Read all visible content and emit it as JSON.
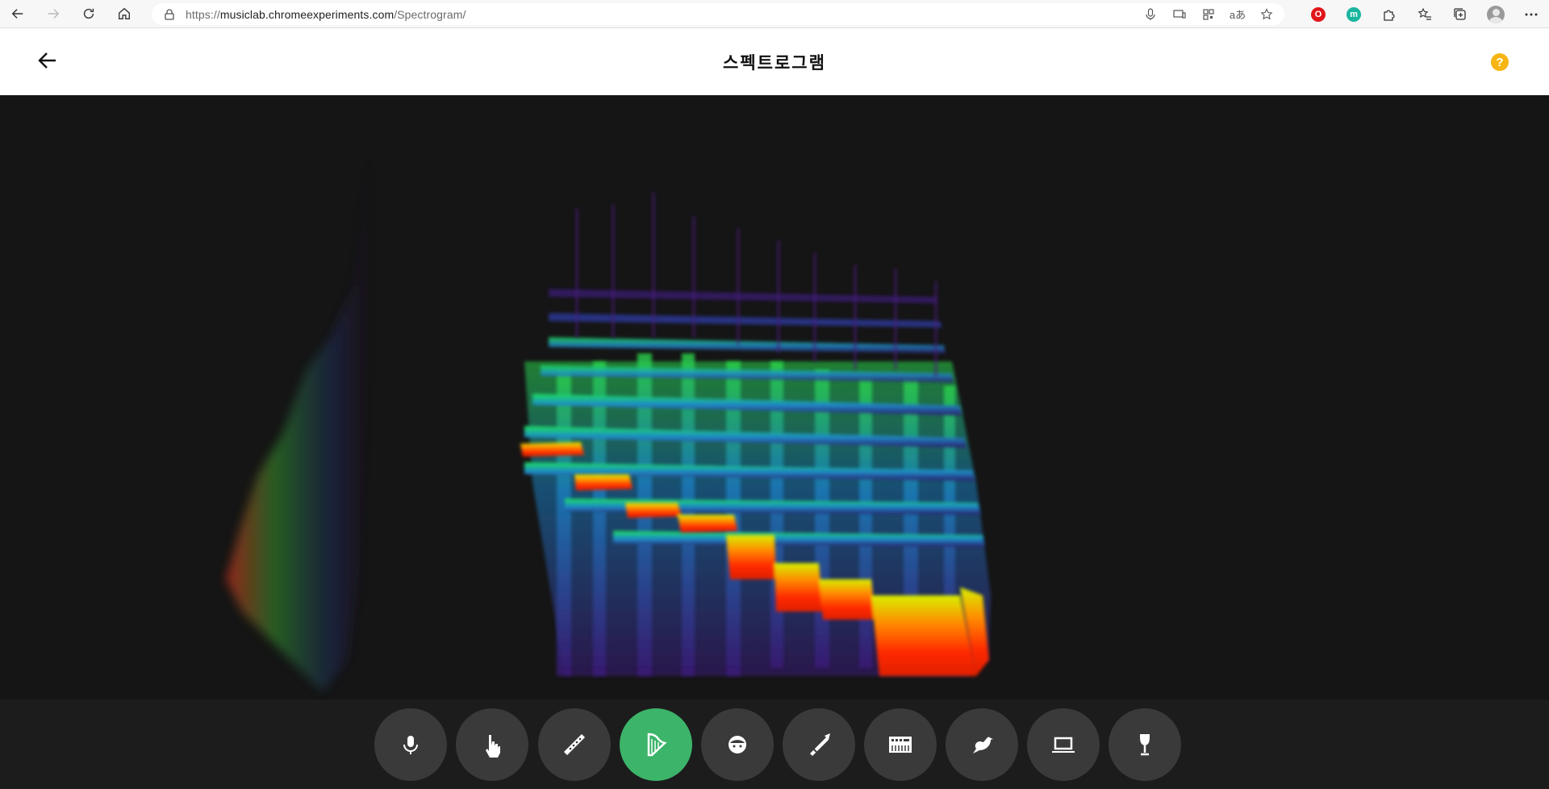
{
  "browser": {
    "url_scheme": "https://",
    "url_host": "musiclab.chromeexperiments.com",
    "url_path": "/Spectrogram/",
    "read_aloud_label": "aあ",
    "opera_label": "O",
    "m_label": "m"
  },
  "header": {
    "title": "스펙트로그램",
    "help_label": "?"
  },
  "toolbar": {
    "active_index": 3,
    "items": [
      {
        "name": "microphone",
        "icon": "microphone-icon"
      },
      {
        "name": "touch",
        "icon": "hand-pointer-icon"
      },
      {
        "name": "flute",
        "icon": "flute-icon"
      },
      {
        "name": "harp",
        "icon": "harp-icon"
      },
      {
        "name": "voice",
        "icon": "face-icon"
      },
      {
        "name": "trombone",
        "icon": "trombone-icon"
      },
      {
        "name": "synth",
        "icon": "synthesizer-icon"
      },
      {
        "name": "bird",
        "icon": "bird-icon"
      },
      {
        "name": "modem",
        "icon": "laptop-icon"
      },
      {
        "name": "wineglass",
        "icon": "wine-glass-icon"
      }
    ]
  },
  "colors": {
    "active": "#3cb46a",
    "button": "#3a3a3a",
    "help": "#f6b511",
    "background": "#151515"
  }
}
